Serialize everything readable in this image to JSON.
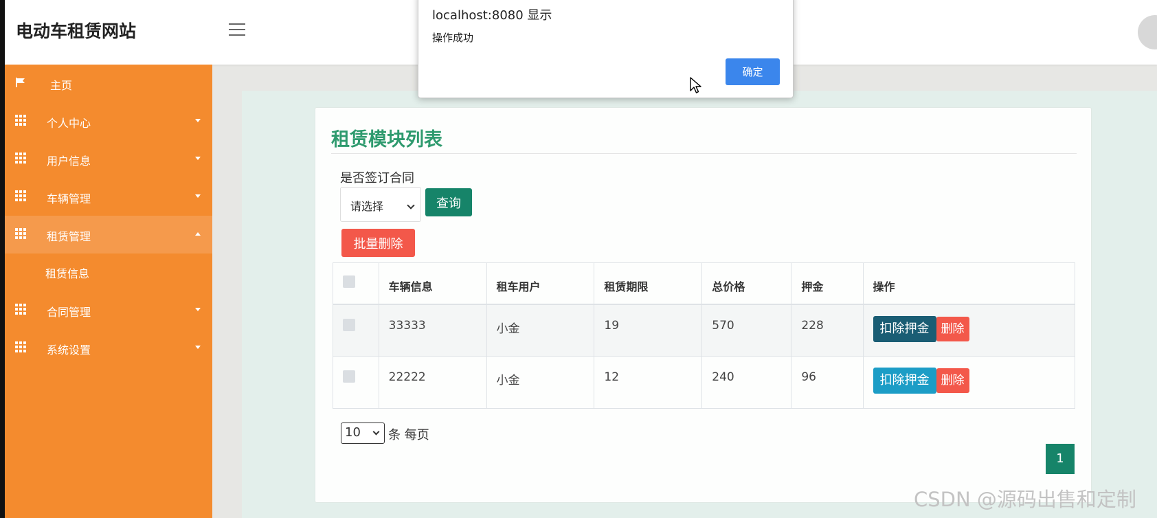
{
  "brand": {
    "title": "电动车租赁网站"
  },
  "sidebar": {
    "items": [
      {
        "label": "主页",
        "icon": "flag-icon"
      },
      {
        "label": "个人中心",
        "icon": "grid-icon",
        "caret": "down"
      },
      {
        "label": "用户信息",
        "icon": "grid-icon",
        "caret": "down"
      },
      {
        "label": "车辆管理",
        "icon": "grid-icon",
        "caret": "down"
      },
      {
        "label": "租赁管理",
        "icon": "grid-icon",
        "caret": "up",
        "active": true
      },
      {
        "label": "租赁信息",
        "sub": true
      },
      {
        "label": "合同管理",
        "icon": "grid-icon",
        "caret": "down"
      },
      {
        "label": "系统设置",
        "icon": "grid-icon",
        "caret": "down"
      }
    ]
  },
  "main": {
    "title": "租赁模块列表",
    "filter": {
      "label": "是否签订合同",
      "select_value": "请选择",
      "query_label": "查询"
    },
    "batch_delete_label": "批量删除",
    "table": {
      "headers": [
        "车辆信息",
        "租车用户",
        "租赁期限",
        "总价格",
        "押金",
        "操作"
      ],
      "rows": [
        {
          "vehicle": "33333",
          "user": "小金",
          "term": "19",
          "total": "570",
          "deposit": "228",
          "deduct_label": "扣除押金",
          "delete_label": "删除"
        },
        {
          "vehicle": "22222",
          "user": "小金",
          "term": "12",
          "total": "240",
          "deposit": "96",
          "deduct_label": "扣除押金",
          "delete_label": "删除"
        }
      ]
    },
    "pagination": {
      "page_size": "10",
      "page_size_suffix": "条 每页",
      "current_page": "1"
    }
  },
  "dialog": {
    "title": "localhost:8080 显示",
    "message": "操作成功",
    "ok_label": "确定"
  },
  "watermark": "CSDN @源码出售和定制",
  "colors": {
    "sidebar": "#f48b2e",
    "primary_green": "#168469",
    "danger": "#f3584a",
    "deduct_dark": "#1a5d74",
    "deduct_light": "#1c9dc6",
    "dialog_ok": "#3b86ec"
  }
}
